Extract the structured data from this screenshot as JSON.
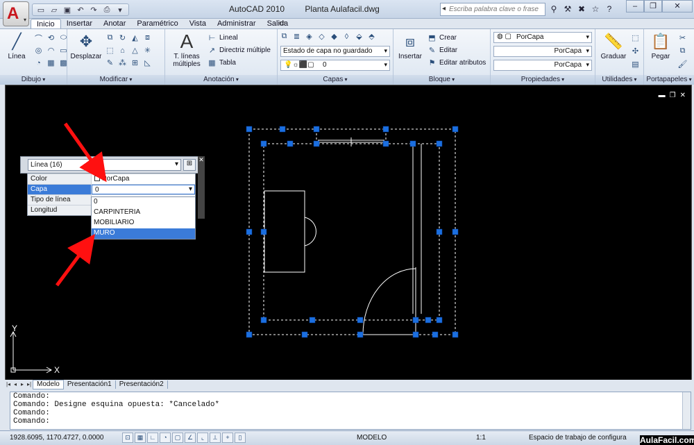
{
  "app": {
    "title": "AutoCAD 2010",
    "file": "Planta Aulafacil.dwg",
    "search_placeholder": "Escriba palabra clave o frase"
  },
  "ribbon_tabs": [
    "Inicio",
    "Insertar",
    "Anotar",
    "Paramétrico",
    "Vista",
    "Administrar",
    "Salida"
  ],
  "panels": {
    "dibujo": {
      "title": "Dibujo",
      "linea": "Línea"
    },
    "modificar": {
      "title": "Modificar",
      "desplazar": "Desplazar"
    },
    "anotacion": {
      "title": "Anotación",
      "texto": "T. líneas múltiples",
      "lineal": "Lineal",
      "directriz": "Directriz múltiple",
      "tabla": "Tabla"
    },
    "capas": {
      "title": "Capas",
      "estado": "Estado de capa no guardado",
      "current": "0"
    },
    "bloque": {
      "title": "Bloque",
      "insertar": "Insertar",
      "crear": "Crear",
      "editar": "Editar",
      "editar_atributos": "Editar atributos"
    },
    "propiedades": {
      "title": "Propiedades",
      "color": "PorCapa",
      "tipo_linea": "PorCapa",
      "grosor": "PorCapa"
    },
    "utilidades": {
      "title": "Utilidades",
      "graduar": "Graduar"
    },
    "portapapeles": {
      "title": "Portapapeles",
      "pegar": "Pegar"
    }
  },
  "quick_props": {
    "selection": "Línea (16)",
    "rows": [
      {
        "key": "Color",
        "value": "PorCapa"
      },
      {
        "key": "Capa",
        "value": "0"
      },
      {
        "key": "Tipo de línea",
        "value": ""
      },
      {
        "key": "Longitud",
        "value": ""
      }
    ],
    "layer_options": [
      "0",
      "CARPINTERIA",
      "MOBILIARIO",
      "MURO"
    ],
    "highlighted_option": "MURO"
  },
  "ucs": {
    "x": "X",
    "y": "Y"
  },
  "layout_tabs": [
    "Modelo",
    "Presentación1",
    "Presentación2"
  ],
  "command_lines": [
    "Comando:",
    "Comando: Designe esquina opuesta: *Cancelado*",
    "Comando:",
    "Comando:"
  ],
  "status": {
    "coords": "1928.6095, 1170.4727, 0.0000",
    "space": "MODELO",
    "scale": "1:1",
    "workspace": "Espacio de trabajo de configura",
    "watermark": "AulaFacil.com"
  },
  "colors": {
    "grip": "#1b6fe0",
    "arrow": "#ff1010",
    "canvas": "#000000",
    "highlight": "#3b7bd8"
  }
}
